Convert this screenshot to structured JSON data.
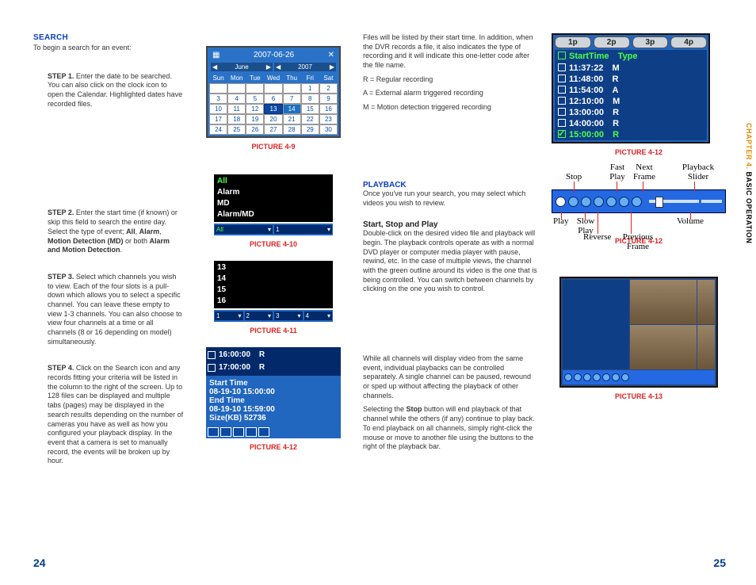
{
  "sidetab": {
    "chapter": "CHAPTER 4.",
    "title": " BASIC OPERATION"
  },
  "left": {
    "section": "SEARCH",
    "intro": "To begin a search for an event:",
    "step1": {
      "label": "STEP 1.",
      "text": " Enter the date to be searched. You can also click on the clock icon to open the Calendar. Highlighted dates have recorded files."
    },
    "step2": {
      "label": "STEP 2.",
      "text_a": " Enter the start time (if known) or skip this field to search the entire day. Select the type of event; ",
      "b1": "All",
      "c1": ", ",
      "b2": "Alarm",
      "c2": ", ",
      "b3": "Motion Detection (MD)",
      "c3": " or both ",
      "b4": "Alarm and Motion Detection",
      "c4": "."
    },
    "step3": {
      "label": "STEP 3.",
      "text": " Select which channels you wish to view. Each of the four slots is a pull-down which allows you to select a specific channel. You can leave these empty to view 1-3 channels. You can also choose to view four channels at a time or all channels (8 or 16 depending on model) simultaneously."
    },
    "step4": {
      "label": "STEP 4.",
      "text": " Click on the Search icon and any records fitting your criteria will be listed in the column to the right of the screen. Up to 128 files can be displayed and multiple tabs (pages) may be displayed in the search results depending on the number of cameras you have as well as how you configured your playback display. In the event that a camera is set to manually record, the events will be broken up by hour."
    }
  },
  "mid": {
    "calendar": {
      "title": "2007-06-26",
      "month": "June",
      "year": "2007",
      "dow": [
        "Sun",
        "Mon",
        "Tue",
        "Wed",
        "Thu",
        "Fri",
        "Sat"
      ],
      "rows": [
        [
          "",
          "",
          "",
          "",
          "",
          "1",
          "2"
        ],
        [
          "3",
          "4",
          "5",
          "6",
          "7",
          "8",
          "9"
        ],
        [
          "10",
          "11",
          "12",
          "13",
          "14",
          "15",
          "16"
        ],
        [
          "17",
          "18",
          "19",
          "20",
          "21",
          "22",
          "23"
        ],
        [
          "24",
          "25",
          "26",
          "27",
          "28",
          "29",
          "30"
        ]
      ],
      "caption": "PICTURE 4-9"
    },
    "eventlist": {
      "items": [
        "All",
        "Alarm",
        "MD",
        "Alarm/MD"
      ],
      "sel_all": "All",
      "sel_1": "1",
      "caption": "PICTURE 4-10"
    },
    "chanlist": {
      "items": [
        "13",
        "14",
        "15",
        "16"
      ],
      "slots": [
        "1",
        "2",
        "3",
        "4"
      ],
      "caption": "PICTURE 4-11"
    },
    "result": {
      "rows": [
        {
          "time": "16:00:00",
          "type": "R"
        },
        {
          "time": "17:00:00",
          "type": "R"
        }
      ],
      "start_lbl": "Start Time",
      "start_val": "08-19-10 15:00:00",
      "end_lbl": "End Time",
      "end_val": "08-19-10 15:59:00",
      "size_lbl": "Size(KB)",
      "size_val": "52736",
      "caption": "PICTURE 4-12"
    }
  },
  "right1": {
    "para1": "Files will be listed by their start time. In addition, when the DVR records a file, it also indicates the type of recording and it will indicate this one-letter code after the file name.",
    "codes": [
      "R = Regular recording",
      "A = External alarm triggered recording",
      "M = Motion detection triggered recording"
    ],
    "playback_hdr": "PLAYBACK",
    "playback_intro": "Once you've run your search, you may select which videos you wish to review.",
    "ssp_hdr": "Start, Stop and Play",
    "ssp_text": "Double-click on the desired video file and playback will begin. The playback controls operate as with a normal DVD player or computer media player with pause, rewind, etc. In the case of multiple views, the channel with the green outline around its video is the one that is being controlled. You can switch between channels by clicking on the one you wish to control.",
    "para_bottom1": "While all channels will display video from the same event, individual playbacks can be controlled separately. A single channel can be paused, rewound or sped up without affecting the playback of other channels.",
    "para_bottom2a": "Selecting the ",
    "para_bottom2b": "Stop",
    "para_bottom2c": " button will end playback of that channel while the others (if any) continue to play back. To end playback on all channels, simply right-click the mouse or move to another file using the buttons to the right of the playback bar."
  },
  "right2": {
    "tabs": [
      "1p",
      "2p",
      "3p",
      "4p"
    ],
    "header": {
      "col1": "StartTime",
      "col2": "Type"
    },
    "rows": [
      {
        "time": "11:37:22",
        "type": "M",
        "sel": false
      },
      {
        "time": "11:48:00",
        "type": "R",
        "sel": false
      },
      {
        "time": "11:54:00",
        "type": "A",
        "sel": false
      },
      {
        "time": "12:10:00",
        "type": "M",
        "sel": false
      },
      {
        "time": "13:00:00",
        "type": "R",
        "sel": false
      },
      {
        "time": "14:00:00",
        "type": "R",
        "sel": false
      },
      {
        "time": "15:00:00",
        "type": "R",
        "sel": true
      }
    ],
    "caption_list": "PICTURE 4-12",
    "pb_labels": {
      "stop": "Stop",
      "fast": "Fast Play",
      "next": "Next Frame",
      "slider": "Playback Slider",
      "play": "Play",
      "slow": "Slow Play",
      "reverse": "Reverse",
      "prev": "Previous Frame",
      "volume": "Volume"
    },
    "caption_pb": "PICTURE 4-12",
    "caption_cam": "PICTURE 4-13"
  },
  "pagenum": {
    "left": "24",
    "right": "25"
  }
}
